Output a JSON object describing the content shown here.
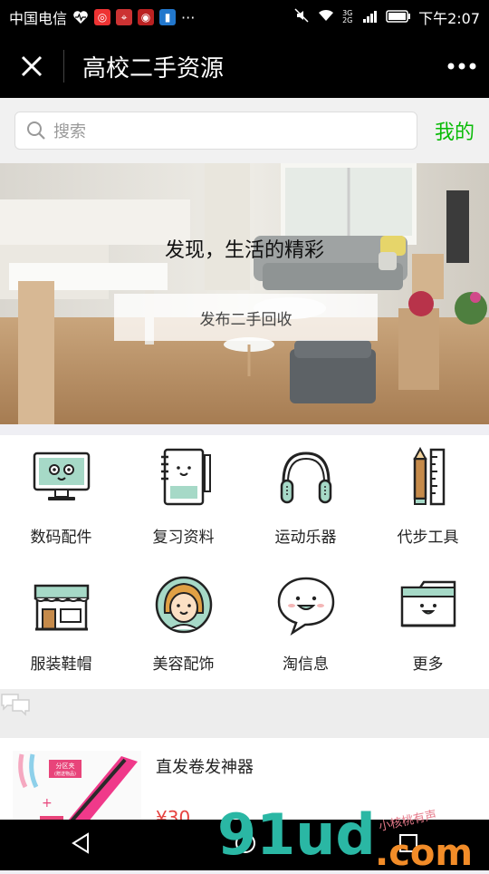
{
  "status_bar": {
    "carrier": "中国电信",
    "time": "下午2:07",
    "network_label": "3G 2G"
  },
  "nav": {
    "title": "高校二手资源"
  },
  "search": {
    "placeholder": "搜索",
    "mine_label": "我的"
  },
  "banner": {
    "headline": "发现，生活的精彩",
    "button_label": "发布二手回收"
  },
  "categories": [
    {
      "label": "数码配件",
      "icon": "monitor-icon"
    },
    {
      "label": "复习资料",
      "icon": "notebook-icon"
    },
    {
      "label": "运动乐器",
      "icon": "headphones-icon"
    },
    {
      "label": "代步工具",
      "icon": "pencil-ruler-icon"
    },
    {
      "label": "服装鞋帽",
      "icon": "shop-icon"
    },
    {
      "label": "美容配饰",
      "icon": "girl-face-icon"
    },
    {
      "label": "淘信息",
      "icon": "chat-bubble-icon"
    },
    {
      "label": "更多",
      "icon": "folder-icon"
    }
  ],
  "listing": {
    "title": "直发卷发神器",
    "price": "¥30",
    "thumb_label_1": "分区夹",
    "thumb_label_2": "(赠送物品)"
  },
  "watermark": {
    "brand": "91ud",
    "suffix": ".com",
    "tagline": "小核桃有声"
  },
  "colors": {
    "accent_green": "#09bb07",
    "price_red": "#e64340",
    "watermark_teal": "#2ab7a4",
    "watermark_orange": "#f28c28"
  }
}
